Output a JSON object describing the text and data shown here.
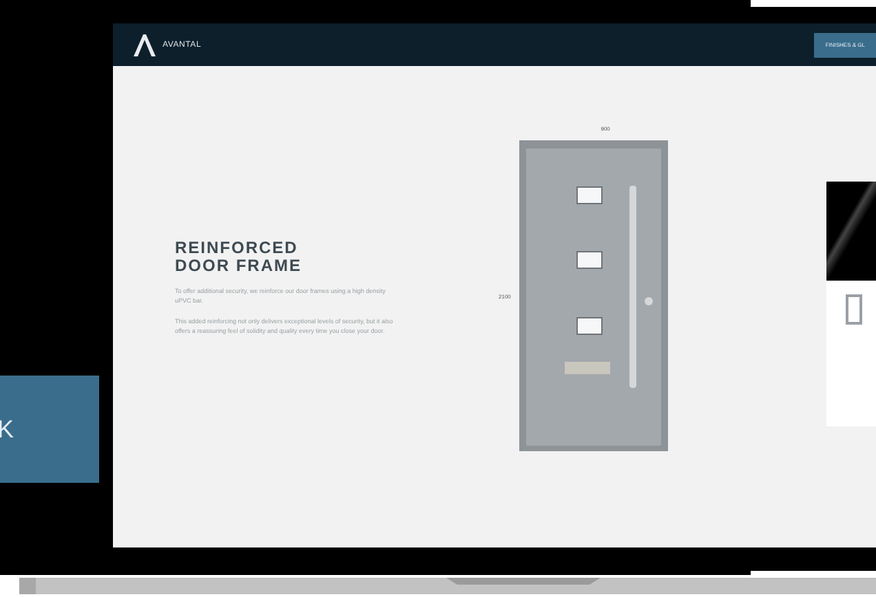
{
  "logo": {
    "text": "AVANTAL"
  },
  "nav": {
    "button": "FINISHES & GL"
  },
  "side_panel": {
    "text": "K"
  },
  "feature": {
    "title_lines": [
      "REINFORCED",
      "DOOR FRAME"
    ],
    "paragraphs": [
      "To offer additional security, we reinforce our door frames using a high density uPVC bar.",
      "This added reinforcing not only delivers exceptional levels of security, but it also offers a reassuring feel of solidity and quality every time you close your door."
    ]
  },
  "door": {
    "width_label": "900",
    "height_label": "2100"
  }
}
